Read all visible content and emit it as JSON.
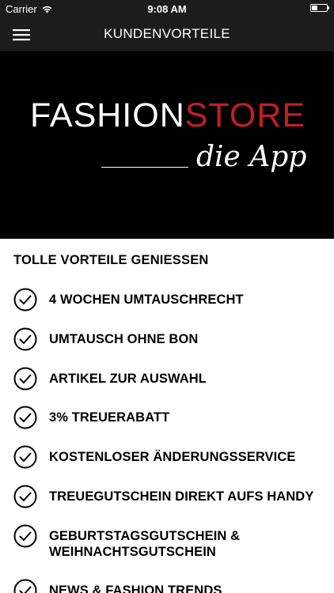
{
  "status_bar": {
    "carrier": "Carrier",
    "time": "9:08 AM",
    "battery_level": 0.4
  },
  "nav": {
    "title": "KUNDENVORTEILE",
    "menu_icon": "hamburger-menu-icon"
  },
  "banner": {
    "logo_part1": "FASHION",
    "logo_part2": "STORE",
    "tagline": "die App",
    "colors": {
      "background": "#000000",
      "logo_white": "#ffffff",
      "logo_red": "#c21e25"
    }
  },
  "content": {
    "heading": "TOLLE VORTEILE GENIESSEN",
    "benefits": [
      {
        "label": "4 WOCHEN UMTAUSCHRECHT"
      },
      {
        "label": "UMTAUSCH OHNE BON"
      },
      {
        "label": "ARTIKEL ZUR AUSWAHL"
      },
      {
        "label": "3% TREUERABATT"
      },
      {
        "label": "KOSTENLOSER ÄNDERUNGSSERVICE"
      },
      {
        "label": "TREUEGUTSCHEIN DIREKT AUFS HANDY"
      },
      {
        "label": "GEBURTSTAGSGUTSCHEIN & WEIHNACHTSGUTSCHEIN"
      },
      {
        "label": "NEWS & FASHION TRENDS"
      }
    ],
    "item_icon": "check-circle-icon"
  }
}
